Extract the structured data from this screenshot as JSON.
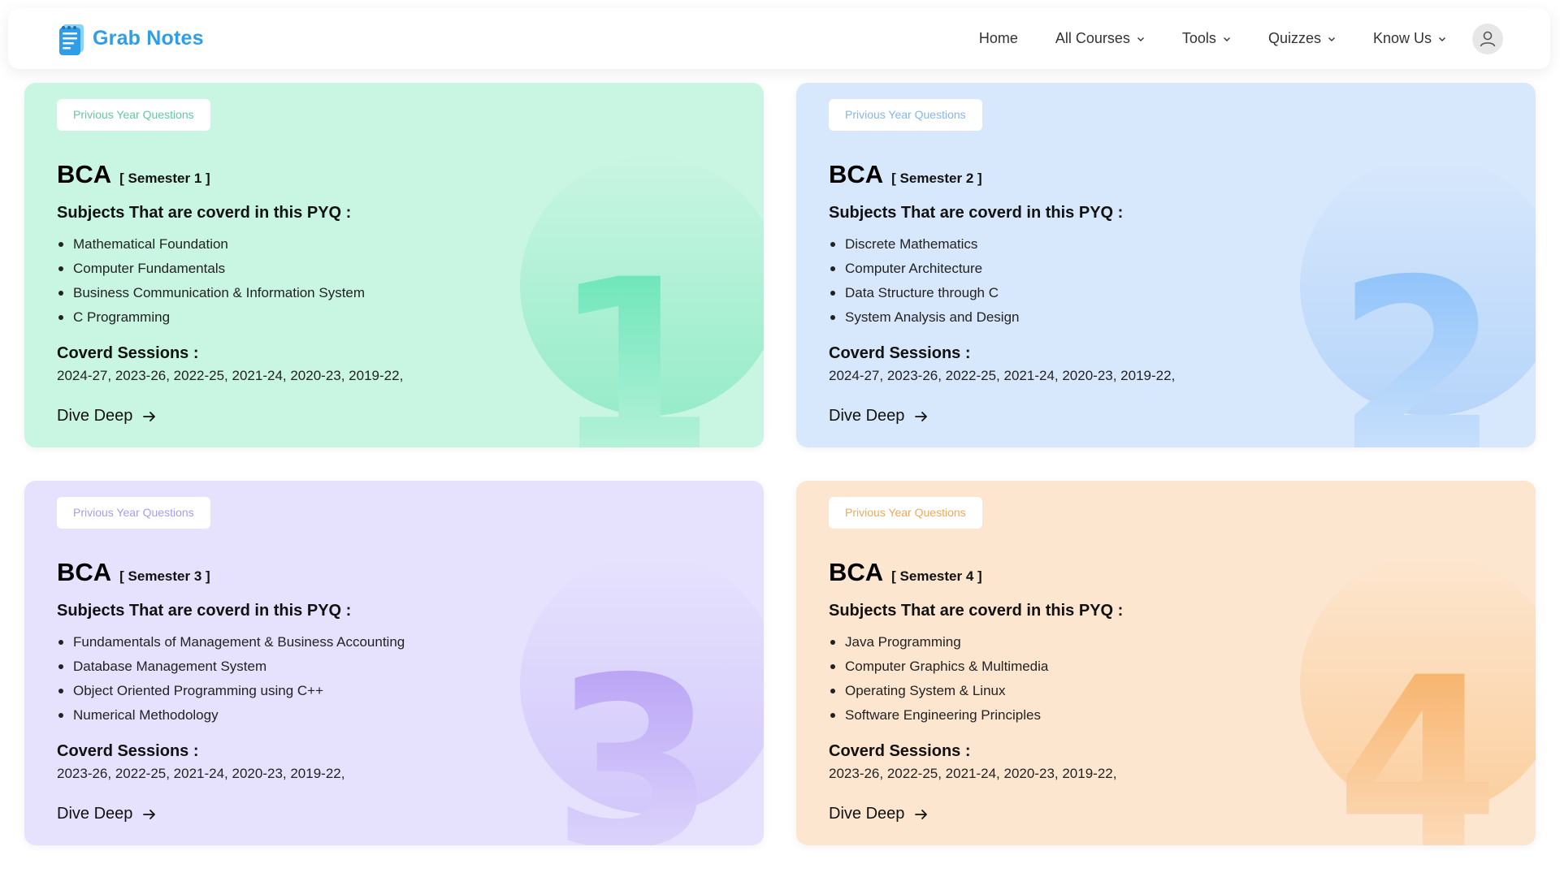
{
  "header": {
    "brand": "Grab Notes",
    "nav": [
      {
        "label": "Home",
        "dropdown": false
      },
      {
        "label": "All Courses",
        "dropdown": true
      },
      {
        "label": "Tools",
        "dropdown": true
      },
      {
        "label": "Quizzes",
        "dropdown": true
      },
      {
        "label": "Know Us",
        "dropdown": true
      }
    ],
    "avatar_icon": "user-icon"
  },
  "cards": [
    {
      "chip": "Privious Year Questions",
      "title": "BCA",
      "semester": "[ Semester 1 ]",
      "subjects_heading": "Subjects That are coverd in this PYQ :",
      "subjects": [
        "Mathematical Foundation",
        "Computer Fundamentals",
        "Business Communication & Information System",
        "C Programming"
      ],
      "sessions_heading": "Coverd Sessions :",
      "sessions": "2024-27, 2023-26, 2022-25, 2021-24, 2020-23, 2019-22,",
      "cta": "Dive Deep",
      "big_number": "1",
      "color": "#c9f5e3"
    },
    {
      "chip": "Privious Year Questions",
      "title": "BCA",
      "semester": "[ Semester 2 ]",
      "subjects_heading": "Subjects That are coverd in this PYQ :",
      "subjects": [
        "Discrete Mathematics",
        "Computer Architecture",
        "Data Structure through C",
        "System Analysis and Design"
      ],
      "sessions_heading": "Coverd Sessions :",
      "sessions": "2024-27, 2023-26, 2022-25, 2021-24, 2020-23, 2019-22,",
      "cta": "Dive Deep",
      "big_number": "2",
      "color": "#d8e8fc"
    },
    {
      "chip": "Privious Year Questions",
      "title": "BCA",
      "semester": "[ Semester 3 ]",
      "subjects_heading": "Subjects That are coverd in this PYQ :",
      "subjects": [
        "Fundamentals of Management & Business Accounting",
        "Database Management System",
        "Object Oriented Programming using C++",
        "Numerical Methodology"
      ],
      "sessions_heading": "Coverd Sessions :",
      "sessions": "2023-26, 2022-25, 2021-24, 2020-23, 2019-22,",
      "cta": "Dive Deep",
      "big_number": "3",
      "color": "#e6e2fd"
    },
    {
      "chip": "Privious Year Questions",
      "title": "BCA",
      "semester": "[ Semester 4 ]",
      "subjects_heading": "Subjects That are coverd in this PYQ :",
      "subjects": [
        "Java Programming",
        "Computer Graphics & Multimedia",
        "Operating System & Linux",
        "Software Engineering Principles"
      ],
      "sessions_heading": "Coverd Sessions :",
      "sessions": "2023-26, 2022-25, 2021-24, 2020-23, 2019-22,",
      "cta": "Dive Deep",
      "big_number": "4",
      "color": "#fde6cf"
    }
  ]
}
